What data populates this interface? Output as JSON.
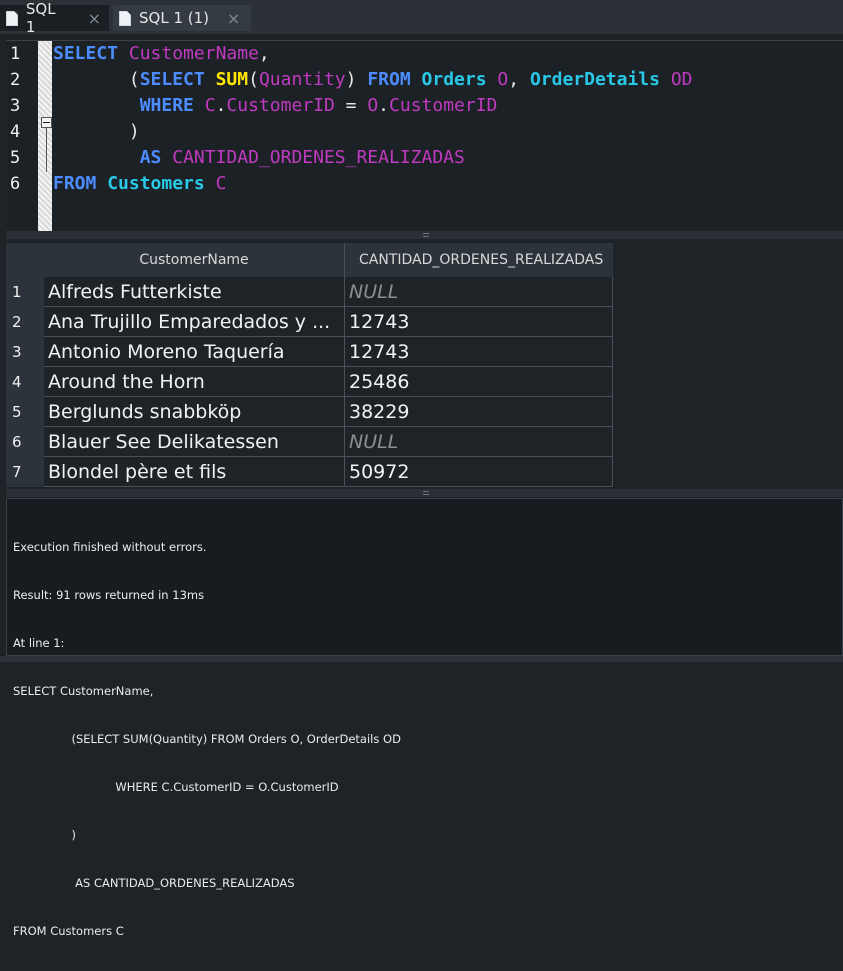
{
  "tabs": [
    {
      "label": "SQL 1",
      "close": "×",
      "active": true
    },
    {
      "label": "SQL 1 (1)",
      "close": "×",
      "active": false
    }
  ],
  "editor": {
    "line_numbers": [
      "1",
      "2",
      "3",
      "4",
      "5",
      "6"
    ],
    "lines": [
      "SELECT CustomerName,",
      "       (SELECT SUM(Quantity) FROM Orders O, OrderDetails OD",
      "        WHERE C.CustomerID = O.CustomerID",
      "       )",
      "        AS CANTIDAD_ORDENES_REALIZADAS",
      "FROM Customers C"
    ],
    "tokens": {
      "select": "SELECT",
      "customername": "CustomerName",
      "comma": ",",
      "lparen": "(",
      "select2": "SELECT",
      "sum": "SUM",
      "lparen2": "(",
      "quantity": "Quantity",
      "rparen2": ")",
      "from": "FROM",
      "orders": "Orders",
      "o": "O",
      "comma2": ",",
      "orderdetails": "OrderDetails",
      "od": "OD",
      "where": "WHERE",
      "c_alias": "C",
      "dot1": ".",
      "customerid1": "CustomerID",
      "eq": "=",
      "o_alias": "O",
      "dot2": ".",
      "customerid2": "CustomerID",
      "rparen": ")",
      "as": "AS",
      "cantidad": "CANTIDAD_ORDENES_REALIZADAS",
      "from2": "FROM",
      "customers": "Customers",
      "c": "C"
    }
  },
  "grid": {
    "columns": [
      "CustomerName",
      "CANTIDAD_ORDENES_REALIZADAS"
    ],
    "rows": [
      {
        "num": "1",
        "name": "Alfreds Futterkiste",
        "value": "NULL",
        "is_null": true
      },
      {
        "num": "2",
        "name": "Ana Trujillo Emparedados y ...",
        "value": "12743",
        "is_null": false
      },
      {
        "num": "3",
        "name": "Antonio Moreno Taquería",
        "value": "12743",
        "is_null": false
      },
      {
        "num": "4",
        "name": "Around the Horn",
        "value": "25486",
        "is_null": false
      },
      {
        "num": "5",
        "name": "Berglunds snabbköp",
        "value": "38229",
        "is_null": false
      },
      {
        "num": "6",
        "name": "Blauer See Delikatessen",
        "value": "NULL",
        "is_null": true
      },
      {
        "num": "7",
        "name": "Blondel père et fils",
        "value": "50972",
        "is_null": false
      }
    ]
  },
  "log": {
    "lines": [
      "Execution finished without errors.",
      "Result: 91 rows returned in 13ms",
      "At line 1:",
      "SELECT CustomerName,",
      "                (SELECT SUM(Quantity) FROM Orders O, OrderDetails OD",
      "                            WHERE C.CustomerID = O.CustomerID",
      "                )",
      "                 AS CANTIDAD_ORDENES_REALIZADAS",
      "FROM Customers C"
    ]
  },
  "colors": {
    "keyword": "#4d8cff",
    "function": "#ffe600",
    "table": "#28c8e6",
    "identifier": "#c03ac0",
    "null_text": "#8a8f94"
  },
  "icons": {
    "tab_icon": "sql-file-icon",
    "close": "close-icon",
    "fold": "fold-toggle-icon",
    "splitter": "splitter-grip-icon"
  }
}
